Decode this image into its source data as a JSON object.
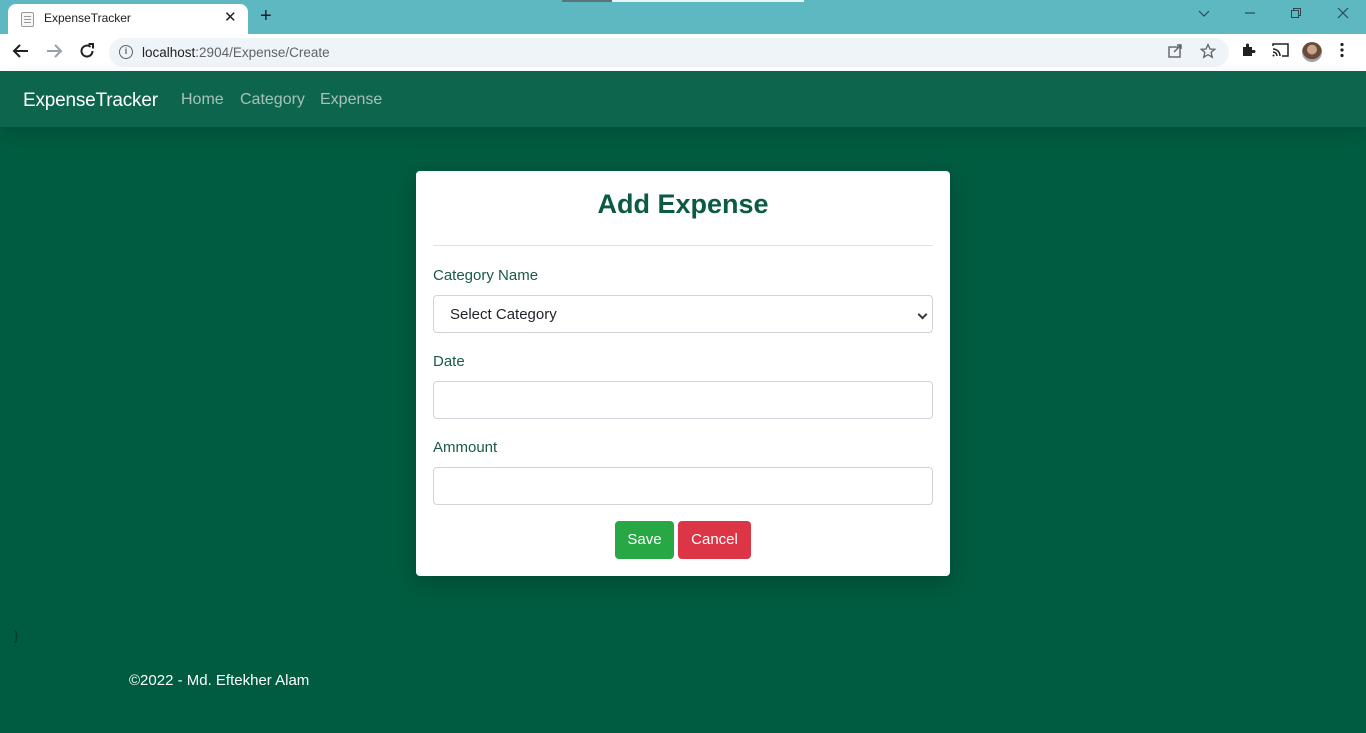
{
  "browser": {
    "tab_title": "ExpenseTracker",
    "tab_close": "✕",
    "new_tab": "+",
    "url_host": "localhost",
    "url_rest": ":2904/Expense/Create",
    "icons": [
      "page-icon",
      "close-icon",
      "plus-icon",
      "chevron-down-icon",
      "minimize-icon",
      "restore-icon",
      "close-window-icon",
      "back-icon",
      "forward-icon",
      "reload-icon",
      "info-icon",
      "share-icon",
      "star-icon",
      "extensions-icon",
      "cast-icon",
      "avatar",
      "menu-icon"
    ]
  },
  "navbar": {
    "brand": "ExpenseTracker",
    "links": [
      "Home",
      "Category",
      "Expense"
    ]
  },
  "form": {
    "title": "Add Expense",
    "category_label": "Category Name",
    "category_selected": "Select Category",
    "date_label": "Date",
    "date_value": "",
    "amount_label": "Ammount",
    "amount_value": "",
    "save_label": "Save",
    "cancel_label": "Cancel"
  },
  "stray_text": "}",
  "footer": "©2022 - Md. Eftekher Alam",
  "colors": {
    "page_bg": "#005c40",
    "navbar_bg": "#0e654e",
    "title": "#0b5a43",
    "save": "#28a745",
    "cancel": "#dc3545",
    "tabbar": "#5db8c2"
  }
}
